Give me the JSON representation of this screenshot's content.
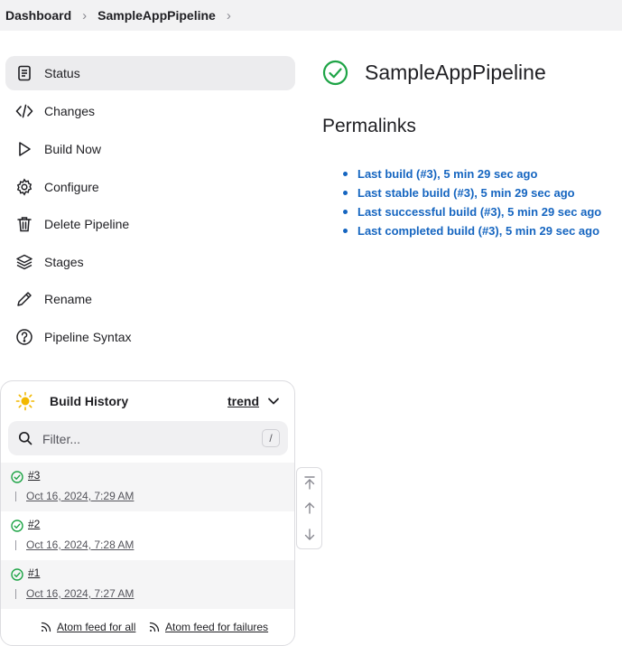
{
  "breadcrumb": {
    "items": [
      "Dashboard",
      "SampleAppPipeline"
    ]
  },
  "sidebar": {
    "items": [
      {
        "label": "Status",
        "icon": "document-icon",
        "active": true
      },
      {
        "label": "Changes",
        "icon": "code-icon"
      },
      {
        "label": "Build Now",
        "icon": "play-icon"
      },
      {
        "label": "Configure",
        "icon": "gear-icon"
      },
      {
        "label": "Delete Pipeline",
        "icon": "trash-icon"
      },
      {
        "label": "Stages",
        "icon": "layers-icon"
      },
      {
        "label": "Rename",
        "icon": "pencil-icon"
      },
      {
        "label": "Pipeline Syntax",
        "icon": "help-icon"
      }
    ]
  },
  "build_history": {
    "title": "Build History",
    "trend_label": "trend",
    "filter_placeholder": "Filter...",
    "filter_shortcut": "/",
    "runs": [
      {
        "number": "#3",
        "date": "Oct 16, 2024, 7:29 AM",
        "status": "success"
      },
      {
        "number": "#2",
        "date": "Oct 16, 2024, 7:28 AM",
        "status": "success"
      },
      {
        "number": "#1",
        "date": "Oct 16, 2024, 7:27 AM",
        "status": "success"
      }
    ],
    "feed_all": "Atom feed for all",
    "feed_failures": "Atom feed for failures"
  },
  "main": {
    "job_title": "SampleAppPipeline",
    "permalinks_title": "Permalinks",
    "permalinks": [
      "Last build (#3), 5 min 29 sec ago",
      "Last stable build (#3), 5 min 29 sec ago",
      "Last successful build (#3), 5 min 29 sec ago",
      "Last completed build (#3), 5 min 29 sec ago"
    ]
  },
  "colors": {
    "success": "#1ea446",
    "link": "#1565c0",
    "sun": "#f2b800"
  }
}
